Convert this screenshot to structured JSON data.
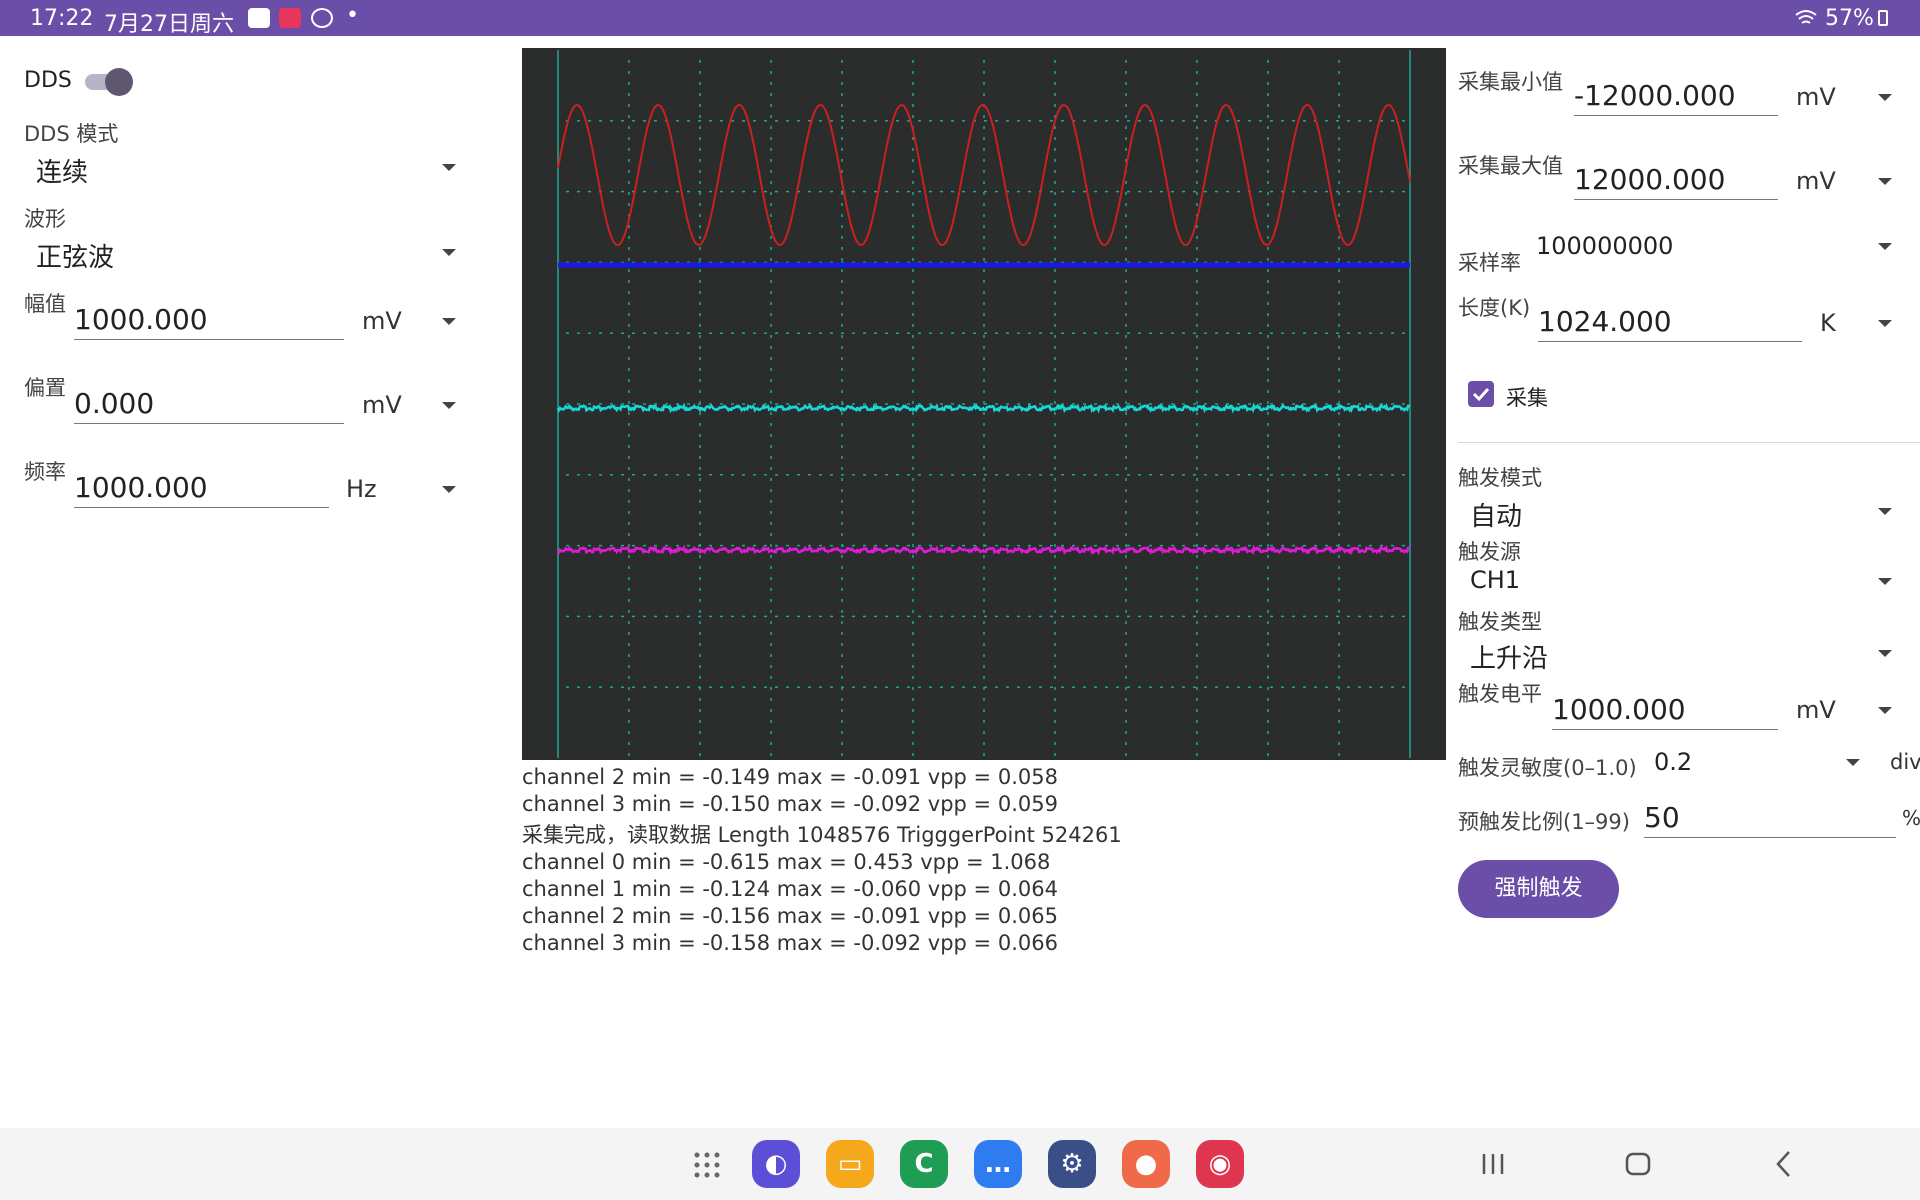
{
  "status_bar": {
    "time": "17:22",
    "date": "7月27日周六",
    "battery": "57%"
  },
  "left_panel": {
    "dds_label": "DDS",
    "dds_enabled": true,
    "mode_label": "DDS 模式",
    "mode_value": "连续",
    "waveform_label": "波形",
    "waveform_value": "正弦波",
    "amplitude_label": "幅值",
    "amplitude_value": "1000.000",
    "amplitude_unit": "mV",
    "offset_label": "偏置",
    "offset_value": "0.000",
    "offset_unit": "mV",
    "frequency_label": "频率",
    "frequency_value": "1000.000",
    "frequency_unit": "Hz"
  },
  "scope": {
    "background": "#2b2d2c",
    "grid_color": "#1fa79a",
    "traces": [
      {
        "color": "#cc1f1f",
        "shape": "sine",
        "cycles": 10.5
      },
      {
        "color": "#1a1ae6",
        "shape": "flat"
      },
      {
        "color": "#18d7d7",
        "shape": "noise"
      },
      {
        "color": "#e01ad6",
        "shape": "noise"
      }
    ]
  },
  "log_lines": [
    "channel 2 min = -0.149 max = -0.091 vpp = 0.058",
    "channel 3 min = -0.150 max = -0.092 vpp = 0.059",
    "采集完成，读取数据 Length 1048576 TrigggerPoint 524261",
    "channel 0 min = -0.615 max = 0.453 vpp = 1.068",
    "channel 1 min = -0.124 max = -0.060 vpp = 0.064",
    "channel 2 min = -0.156 max = -0.091 vpp = 0.065",
    "channel 3 min = -0.158 max = -0.092 vpp = 0.066"
  ],
  "right_panel": {
    "acq_min_label": "采集最小值",
    "acq_min_value": "-12000.000",
    "acq_min_unit": "mV",
    "acq_max_label": "采集最大值",
    "acq_max_value": "12000.000",
    "acq_max_unit": "mV",
    "sample_rate_label": "采样率",
    "sample_rate_value": "100000000",
    "length_label": "长度(K)",
    "length_value": "1024.000",
    "length_unit": "K",
    "acquire_label": "采集",
    "acquire_checked": true,
    "trigger_mode_label": "触发模式",
    "trigger_mode_value": "自动",
    "trigger_source_label": "触发源",
    "trigger_source_value": "CH1",
    "trigger_type_label": "触发类型",
    "trigger_type_value": "上升沿",
    "trigger_level_label": "触发电平",
    "trigger_level_value": "1000.000",
    "trigger_level_unit": "mV",
    "trigger_sens_label": "触发灵敏度(0–1.0)",
    "trigger_sens_value": "0.2",
    "trigger_sens_unit": "div",
    "pretrigger_label": "预触发比例(1–99)",
    "pretrigger_value": "50",
    "pretrigger_unit": "%",
    "force_trigger_label": "强制触发"
  },
  "accent_color": "#6a4ea8"
}
